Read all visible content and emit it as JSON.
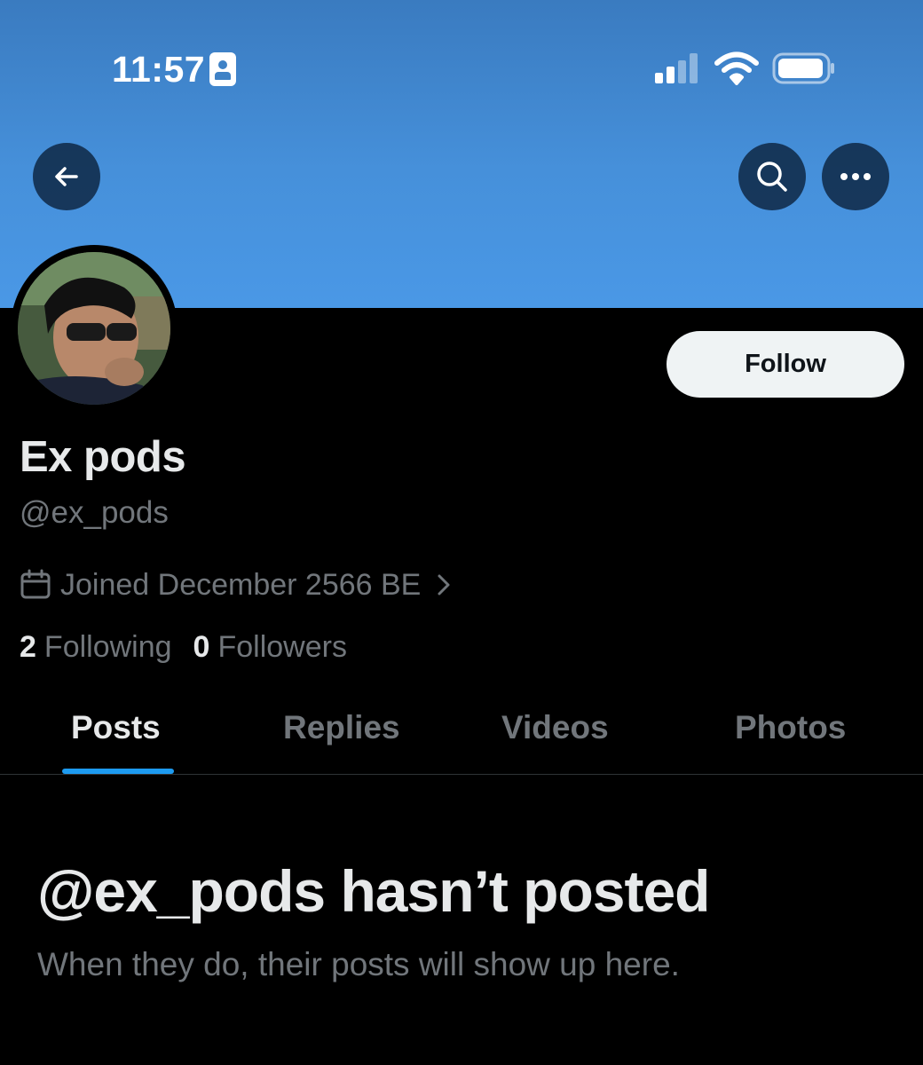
{
  "status_bar": {
    "time": "11:57",
    "icons": [
      "person-badge-icon",
      "signal-icon",
      "wifi-icon",
      "battery-icon"
    ]
  },
  "header": {
    "back_icon": "arrow-left-icon",
    "search_icon": "search-icon",
    "more_icon": "ellipsis-icon",
    "banner_color": "#4690da"
  },
  "profile": {
    "display_name": "Ex pods",
    "handle": "@ex_pods",
    "joined": "Joined December 2566 BE",
    "follow_label": "Follow",
    "following_count": "2",
    "following_label": "Following",
    "followers_count": "0",
    "followers_label": "Followers"
  },
  "tabs": [
    {
      "label": "Posts",
      "active": true
    },
    {
      "label": "Replies",
      "active": false
    },
    {
      "label": "Videos",
      "active": false
    },
    {
      "label": "Photos",
      "active": false
    }
  ],
  "empty_state": {
    "title": "@ex_pods hasn’t posted",
    "subtitle": "When they do, their posts will show up here."
  },
  "colors": {
    "accent": "#1d9bf0",
    "background": "#000000",
    "text_primary": "#e7e9ea",
    "text_secondary": "#71767b"
  }
}
